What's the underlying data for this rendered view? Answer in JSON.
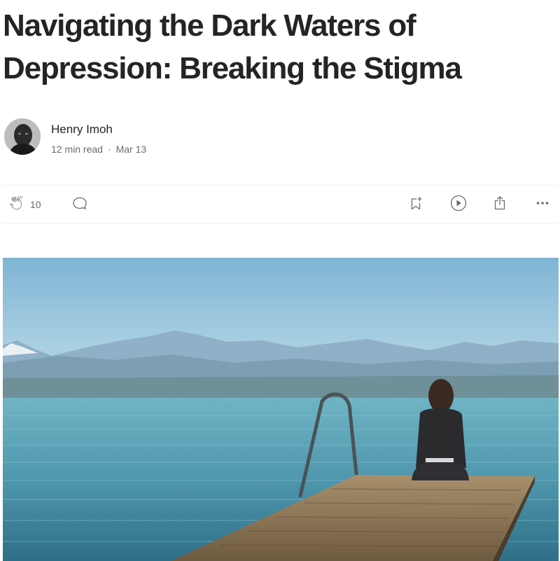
{
  "article": {
    "title": "Navigating the Dark Waters of Depression: Breaking the Stigma"
  },
  "author": {
    "name": "Henry Imoh",
    "read_time": "12 min read",
    "separator": "·",
    "date": "Mar 13"
  },
  "actions": {
    "clap_count": "10",
    "icons": [
      "clap-icon",
      "comment-icon",
      "bookmark-add-icon",
      "play-icon",
      "share-icon",
      "more-icon"
    ]
  },
  "colors": {
    "text": "#242424",
    "muted": "#6b6b6b",
    "divider": "#f0f0f0"
  }
}
